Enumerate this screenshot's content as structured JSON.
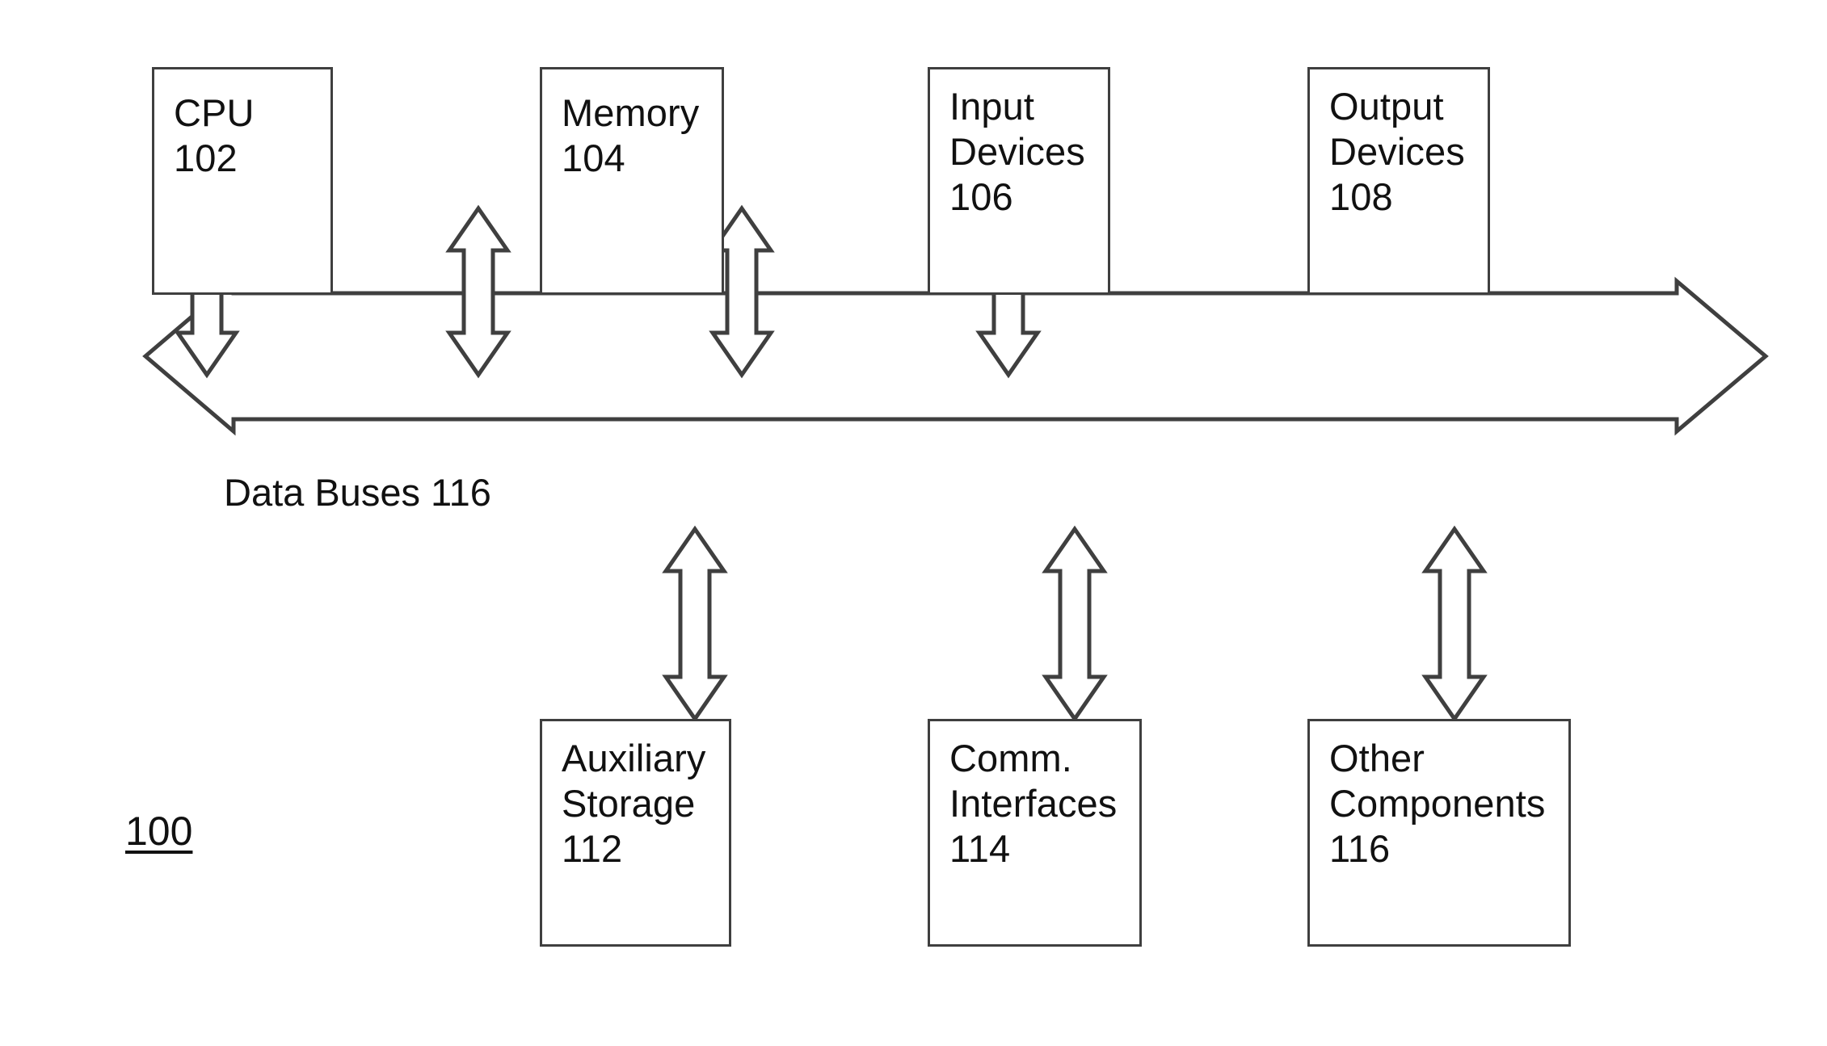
{
  "figure": {
    "reference_numeral": "100",
    "stroke_color": "#3f3f3f",
    "text_color": "#111111",
    "background_color": "#ffffff"
  },
  "bus": {
    "label": "Data Buses 116",
    "name": "Data Buses",
    "numeral": "116",
    "direction": "bidirectional-horizontal"
  },
  "top_row": [
    {
      "name": "CPU",
      "numeral": "102",
      "lines": [
        "CPU",
        "102"
      ]
    },
    {
      "name": "Memory",
      "numeral": "104",
      "lines": [
        "Memory",
        "104"
      ]
    },
    {
      "name": "Input Devices",
      "numeral": "106",
      "lines": [
        "Input",
        "Devices",
        "106"
      ]
    },
    {
      "name": "Output Devices",
      "numeral": "108",
      "lines": [
        "Output",
        "Devices",
        "108"
      ]
    }
  ],
  "bottom_row": [
    {
      "name": "Auxiliary Storage",
      "numeral": "112",
      "lines": [
        "Auxiliary",
        "Storage",
        "112"
      ]
    },
    {
      "name": "Comm. Interfaces",
      "numeral": "114",
      "lines": [
        "Comm.",
        "Interfaces",
        "114"
      ]
    },
    {
      "name": "Other Components",
      "numeral": "116",
      "lines": [
        "Other",
        "Components",
        "116"
      ]
    }
  ],
  "connectors": {
    "count": 7,
    "style": "double-headed-hollow-arrow",
    "top_connector_labels": [
      "cpu-to-bus",
      "memory-to-bus",
      "input-devices-to-bus",
      "output-devices-to-bus"
    ],
    "bottom_connector_labels": [
      "bus-to-auxiliary-storage",
      "bus-to-comm-interfaces",
      "bus-to-other-components"
    ]
  }
}
